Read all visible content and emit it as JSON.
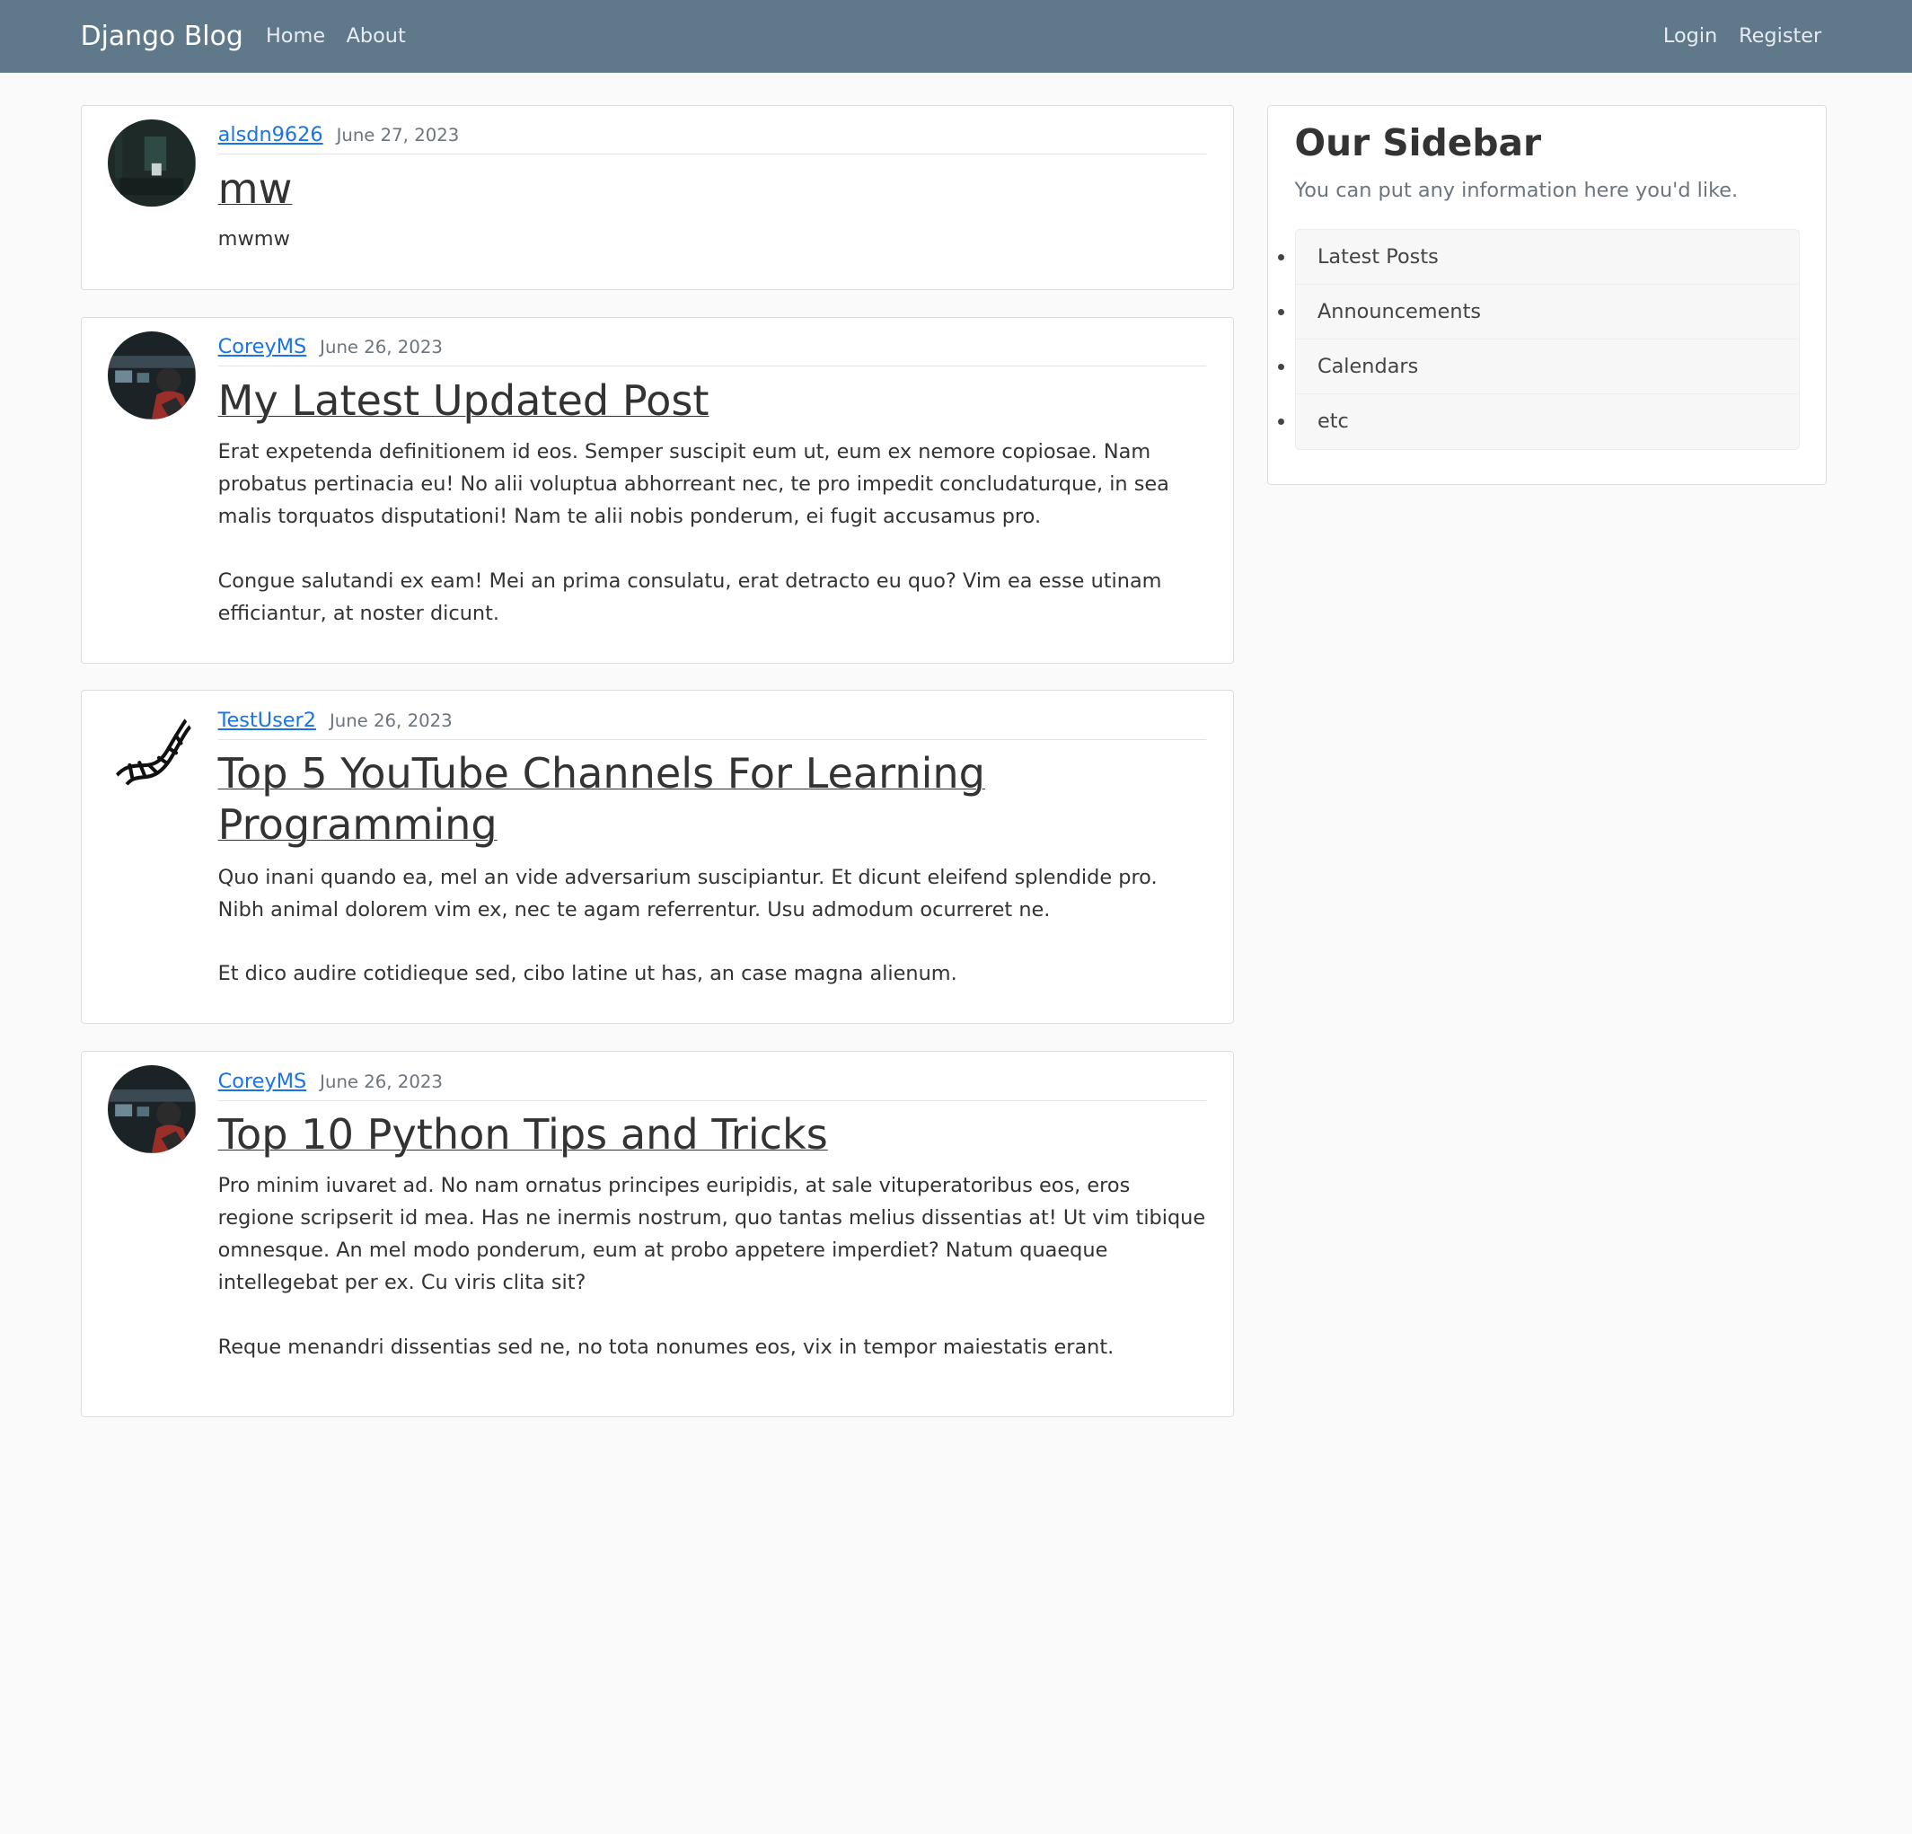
{
  "navbar": {
    "brand": "Django Blog",
    "links": [
      "Home",
      "About"
    ],
    "auth_links": [
      "Login",
      "Register"
    ]
  },
  "posts": [
    {
      "author": "alsdn9626",
      "date": "June 27, 2023",
      "title": "mw",
      "content": "mwmw",
      "avatar": "dark-room-photo"
    },
    {
      "author": "CoreyMS",
      "date": "June 26, 2023",
      "title": "My Latest Updated Post",
      "content": "Erat expetenda definitionem id eos. Semper suscipit eum ut, eum ex nemore copiosae. Nam probatus pertinacia eu! No alii voluptua abhorreant nec, te pro impedit concludaturque, in sea malis torquatos disputationi! Nam te alii nobis ponderum, ei fugit accusamus pro.\n\nCongue salutandi ex eam! Mei an prima consulatu, erat detracto eu quo? Vim ea esse utinam efficiantur, at noster dicunt.",
      "avatar": "person-at-computer-photo"
    },
    {
      "author": "TestUser2",
      "date": "June 26, 2023",
      "title": "Top 5 YouTube Channels For Learning Programming",
      "content": "Quo inani quando ea, mel an vide adversarium suscipiantur. Et dicunt eleifend splendide pro. Nibh animal dolorem vim ex, nec te agam referrentur. Usu admodum ocurreret ne.\n\nEt dico audire cotidieque sed, cibo latine ut has, an case magna alienum.",
      "avatar": "dna-icon"
    },
    {
      "author": "CoreyMS",
      "date": "June 26, 2023",
      "title": "Top 10 Python Tips and Tricks",
      "content": "Pro minim iuvaret ad. No nam ornatus principes euripidis, at sale vituperatoribus eos, eros regione scripserit id mea. Has ne inermis nostrum, quo tantas melius dissentias at! Ut vim tibique omnesque. An mel modo ponderum, eum at probo appetere imperdiet? Natum quaeque intellegebat per ex. Cu viris clita sit?\n\nReque menandri dissentias sed ne, no tota nonumes eos, vix in tempor maiestatis erant.",
      "avatar": "person-at-computer-photo"
    }
  ],
  "sidebar": {
    "title": "Our Sidebar",
    "description": "You can put any information here you'd like.",
    "items": [
      "Latest Posts",
      "Announcements",
      "Calendars",
      "etc"
    ]
  }
}
